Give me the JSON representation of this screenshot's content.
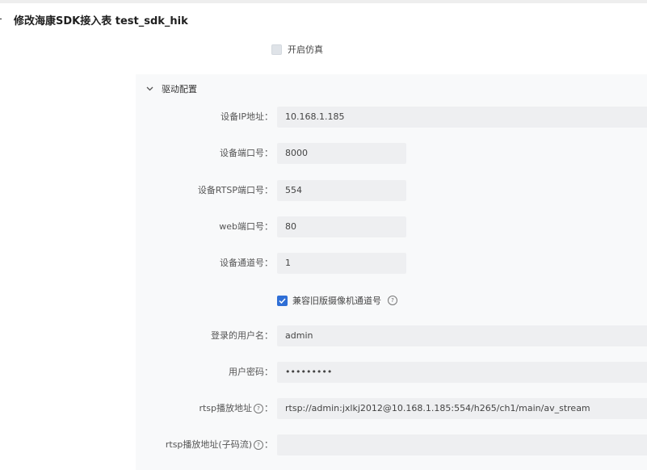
{
  "header": {
    "dash": "-",
    "title": "修改海康SDK接入表 test_sdk_hik"
  },
  "simulation": {
    "label": "开启仿真",
    "checked": false
  },
  "section": {
    "title": "驱动配置",
    "expanded": true
  },
  "fields": {
    "ip": {
      "label": "设备IP地址：",
      "value": "10.168.1.185"
    },
    "port": {
      "label": "设备端口号：",
      "value": "8000"
    },
    "rtsp_port": {
      "label": "设备RTSP端口号：",
      "value": "554"
    },
    "web_port": {
      "label": "web端口号：",
      "value": "80"
    },
    "channel": {
      "label": "设备通道号：",
      "value": "1"
    },
    "username": {
      "label": "登录的用户名：",
      "value": "admin"
    },
    "password": {
      "label": "用户密码：",
      "value": "•••••••••"
    },
    "rtsp_url": {
      "label": "rtsp播放地址",
      "label_suffix": "：",
      "value": "rtsp://admin:jxlkj2012@10.168.1.185:554/h265/ch1/main/av_stream"
    },
    "rtsp_sub_url": {
      "label": "rtsp播放地址(子码流)",
      "label_suffix": "：",
      "value": ""
    }
  },
  "compat": {
    "label": "兼容旧版摄像机通道号",
    "checked": true,
    "help_icon": "question-circle-icon"
  },
  "icons": {
    "section_toggle": "chevron-down-icon",
    "help": "question-circle-icon"
  },
  "colors": {
    "checkbox_checked": "#2f6fd6",
    "input_bg": "#eeeff1",
    "panel_bg": "#f8f9fa"
  }
}
